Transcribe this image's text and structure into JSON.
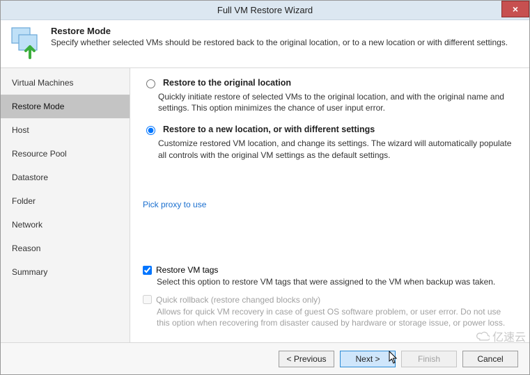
{
  "window": {
    "title": "Full VM Restore Wizard",
    "close_label": "×"
  },
  "header": {
    "title": "Restore Mode",
    "description": "Specify whether selected VMs should be restored back to the original location, or to a new location or with different settings."
  },
  "sidebar": {
    "items": [
      {
        "label": "Virtual Machines",
        "active": false
      },
      {
        "label": "Restore Mode",
        "active": true
      },
      {
        "label": "Host",
        "active": false
      },
      {
        "label": "Resource Pool",
        "active": false
      },
      {
        "label": "Datastore",
        "active": false
      },
      {
        "label": "Folder",
        "active": false
      },
      {
        "label": "Network",
        "active": false
      },
      {
        "label": "Reason",
        "active": false
      },
      {
        "label": "Summary",
        "active": false
      }
    ]
  },
  "main": {
    "option1": {
      "label": "Restore to the original location",
      "description": "Quickly initiate restore of selected VMs to the original location, and with the original name and settings. This option minimizes the chance of user input error.",
      "selected": false
    },
    "option2": {
      "label": "Restore to a new location, or with different settings",
      "description": "Customize restored VM location, and change its settings. The wizard will automatically populate all controls with the original VM settings as the default settings.",
      "selected": true
    },
    "proxy_link": "Pick proxy to use",
    "restore_tags": {
      "label": "Restore VM tags",
      "description": "Select this option to restore VM tags that were assigned to the VM when backup was taken.",
      "checked": true
    },
    "quick_rollback": {
      "label": "Quick rollback (restore changed blocks only)",
      "description": "Allows for quick VM recovery in case of guest OS software problem, or user error. Do not use this option when recovering from disaster caused by hardware or storage issue, or power loss.",
      "checked": false,
      "enabled": false
    }
  },
  "footer": {
    "previous": "< Previous",
    "next": "Next >",
    "finish": "Finish",
    "cancel": "Cancel"
  },
  "watermark": "亿速云"
}
